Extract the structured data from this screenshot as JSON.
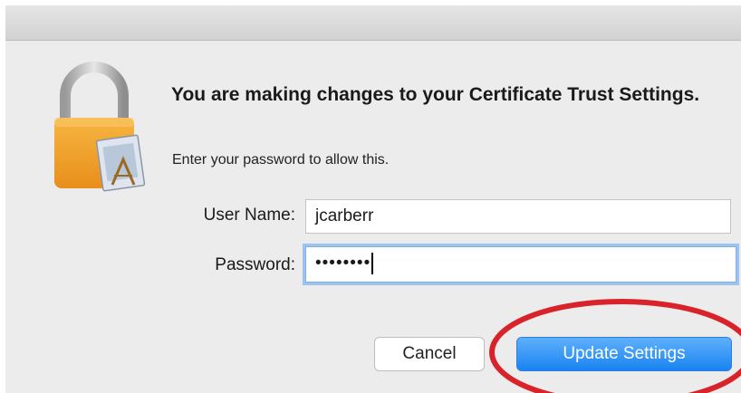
{
  "dialog": {
    "heading": "You are making changes to your Certificate Trust Settings.",
    "subtext": "Enter your password to allow this.",
    "icon": "padlock-with-certificate-icon"
  },
  "form": {
    "username_label": "User Name:",
    "username_value": "jcarberr",
    "password_label": "Password:",
    "password_value": "••••••••"
  },
  "buttons": {
    "cancel_label": "Cancel",
    "update_label": "Update Settings"
  },
  "colors": {
    "accent": "#1a83f1",
    "annotation": "#d9232a",
    "focus_ring": "#9cc3f0"
  }
}
